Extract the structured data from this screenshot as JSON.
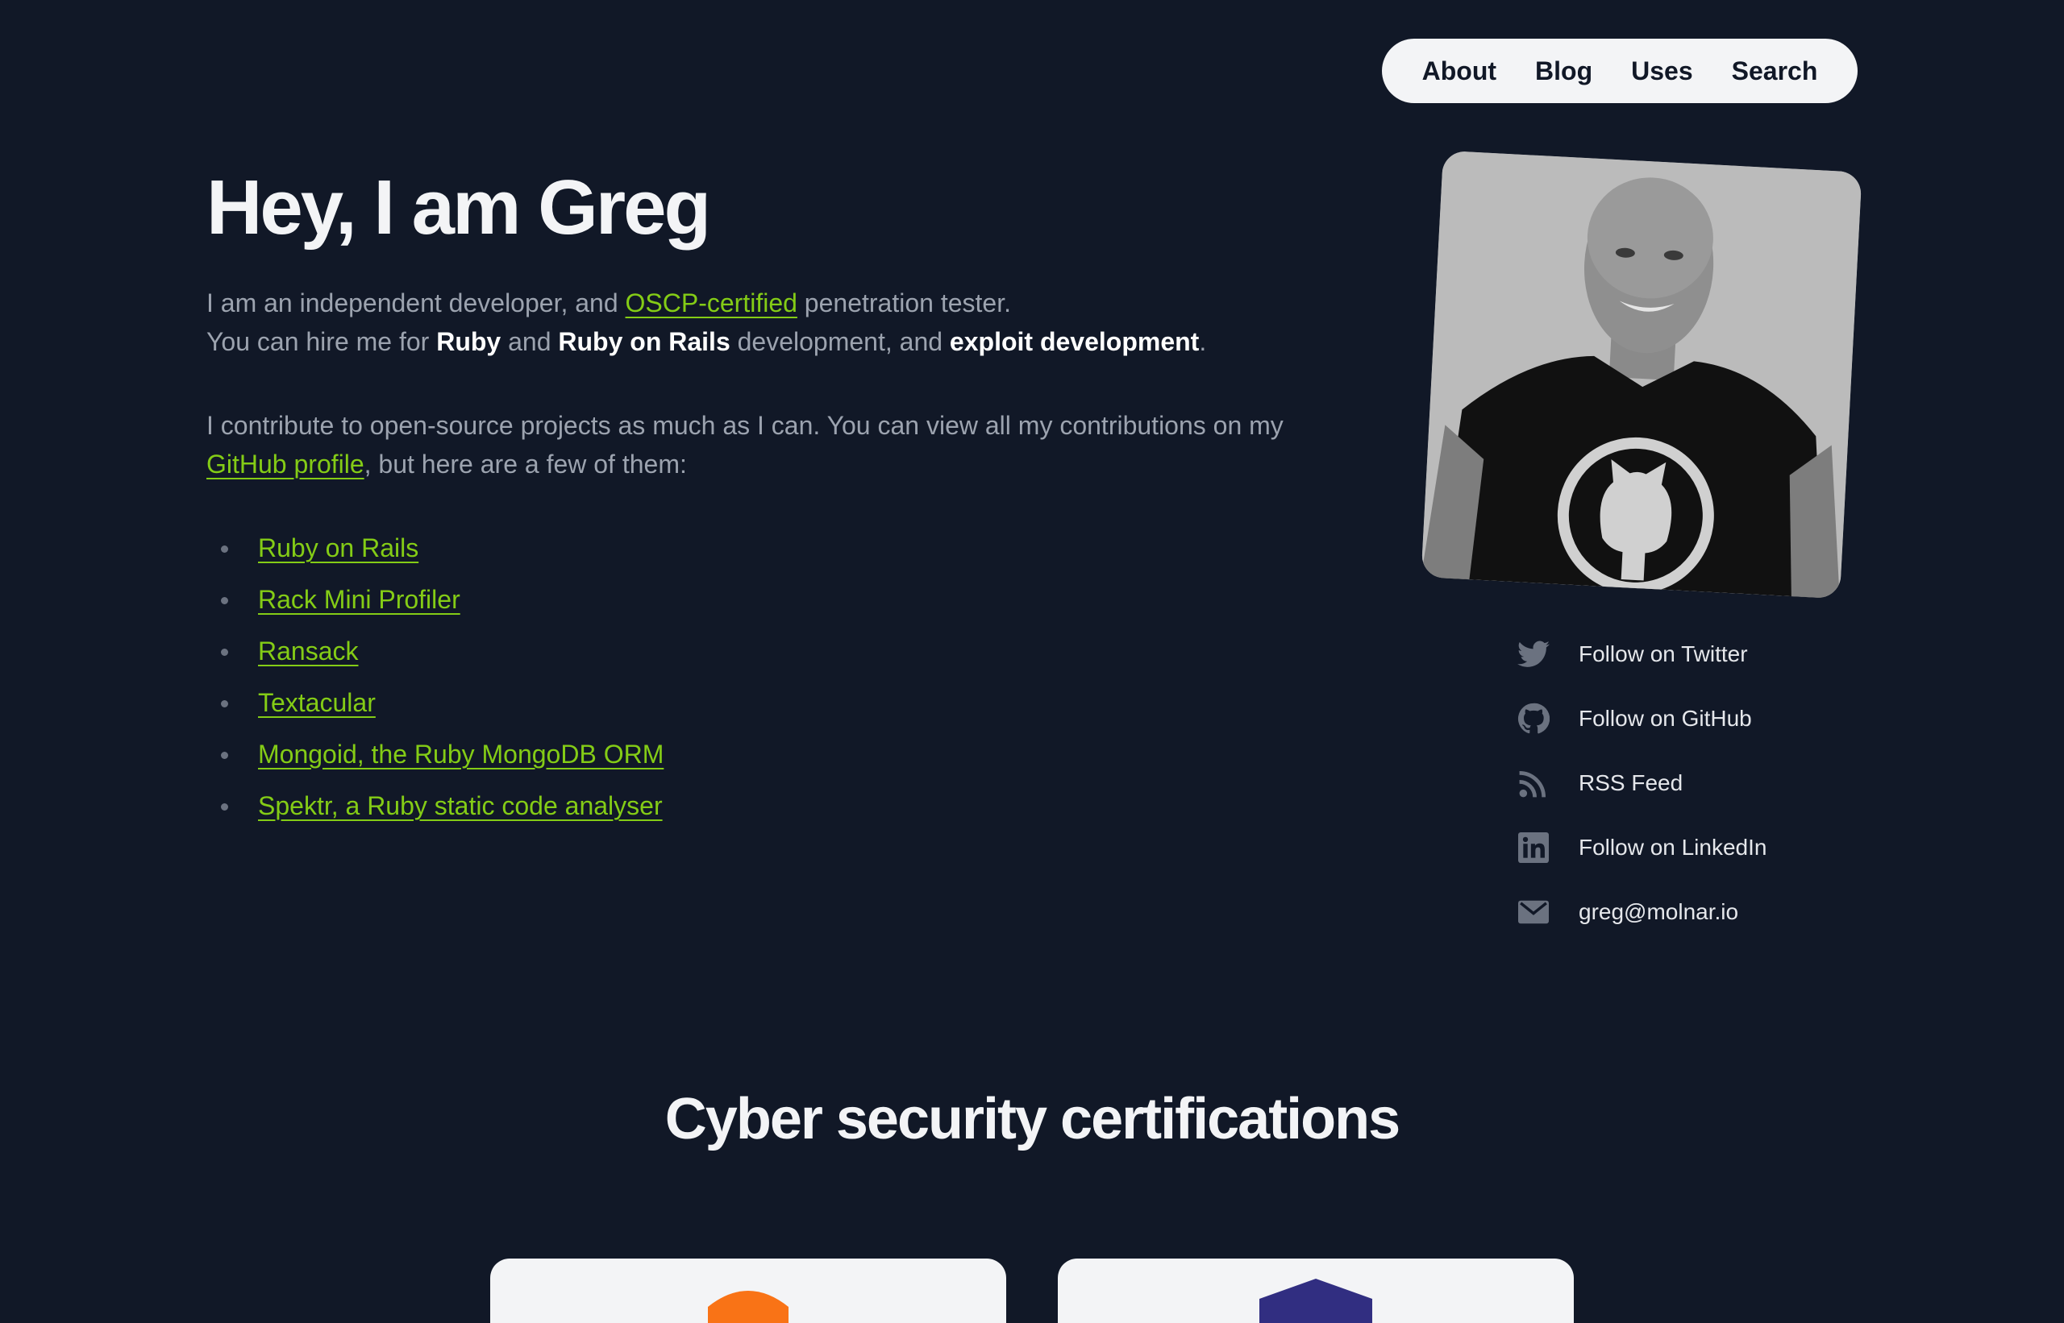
{
  "nav": {
    "items": [
      {
        "label": "About"
      },
      {
        "label": "Blog"
      },
      {
        "label": "Uses"
      },
      {
        "label": "Search"
      }
    ]
  },
  "hero": {
    "title": "Hey, I am Greg",
    "intro": {
      "line1_prefix": "I am an independent developer, and ",
      "oscp_link": "OSCP-certified",
      "line1_suffix": " penetration tester.",
      "line2_prefix": "You can hire me for ",
      "ruby": "Ruby",
      "and1": " and ",
      "rails": "Ruby on Rails",
      "line2_middle": " development, and ",
      "exploit": "exploit development",
      "line2_end": "."
    },
    "contrib": {
      "prefix": "I contribute to open-source projects as much as I can. You can view all my contributions on my ",
      "github_link": "GitHub profile",
      "suffix": ", but here are a few of them:"
    },
    "projects": [
      {
        "label": "Ruby on Rails"
      },
      {
        "label": "Rack Mini Profiler"
      },
      {
        "label": "Ransack"
      },
      {
        "label": "Textacular"
      },
      {
        "label": "Mongoid, the Ruby MongoDB ORM"
      },
      {
        "label": "Spektr, a Ruby static code analyser"
      }
    ]
  },
  "social": [
    {
      "icon": "twitter-icon",
      "label": "Follow on Twitter"
    },
    {
      "icon": "github-icon",
      "label": "Follow on GitHub"
    },
    {
      "icon": "rss-icon",
      "label": "RSS Feed"
    },
    {
      "icon": "linkedin-icon",
      "label": "Follow on LinkedIn"
    },
    {
      "icon": "mail-icon",
      "label": "greg@molnar.io"
    }
  ],
  "certifications": {
    "title": "Cyber security certifications"
  },
  "colors": {
    "background": "#111827",
    "accent": "#84cc16",
    "nav_bg": "#f3f4f6",
    "text_muted": "#9ca3af"
  }
}
